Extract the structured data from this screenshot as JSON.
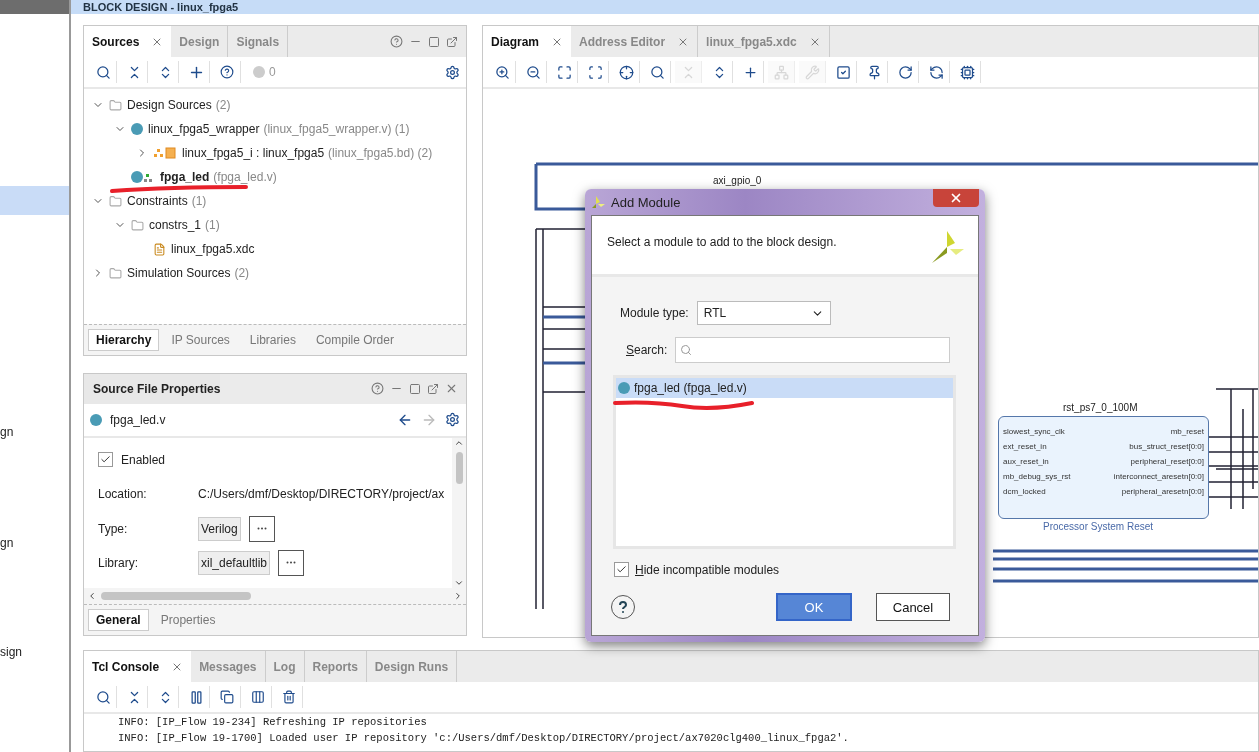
{
  "header": {
    "title": "BLOCK DESIGN - linux_fpga5"
  },
  "left_strip": {
    "items": [
      {
        "label": "gn"
      },
      {
        "label": "gn"
      },
      {
        "label": "sign"
      }
    ]
  },
  "sources_panel": {
    "tabs": [
      {
        "label": "Sources",
        "selected": true,
        "closable": true
      },
      {
        "label": "Design",
        "selected": false,
        "closable": false
      },
      {
        "label": "Signals",
        "selected": false,
        "closable": false
      }
    ],
    "warning_count": "0",
    "tree": [
      {
        "label": "Design Sources",
        "note": "(2)",
        "kind": "folder",
        "expanded": true,
        "bold": false,
        "children": [
          {
            "label": "linux_fpga5_wrapper",
            "note": "(linux_fpga5_wrapper.v) (1)",
            "kind": "module",
            "expanded": true,
            "bold": false,
            "children": [
              {
                "label": "linux_fpga5_i : linux_fpga5",
                "note": "(linux_fpga5.bd) (2)",
                "kind": "block-design",
                "expanded": false,
                "bold": false
              }
            ]
          },
          {
            "label": "fpga_led",
            "note": "(fpga_led.v)",
            "kind": "top-module",
            "bold": true
          }
        ]
      },
      {
        "label": "Constraints",
        "note": "(1)",
        "kind": "folder",
        "expanded": true,
        "bold": false,
        "children": [
          {
            "label": "constrs_1",
            "note": "(1)",
            "kind": "folder",
            "expanded": true,
            "bold": false,
            "children": [
              {
                "label": "linux_fpga5.xdc",
                "kind": "file",
                "bold": false
              }
            ]
          }
        ]
      },
      {
        "label": "Simulation Sources",
        "note": "(2)",
        "kind": "folder",
        "expanded": false,
        "bold": false
      }
    ],
    "bottom_tabs": [
      {
        "label": "Hierarchy",
        "selected": true
      },
      {
        "label": "IP Sources",
        "selected": false
      },
      {
        "label": "Libraries",
        "selected": false
      },
      {
        "label": "Compile Order",
        "selected": false
      }
    ]
  },
  "properties_panel": {
    "title": "Source File Properties",
    "file": "fpga_led.v",
    "enabled": {
      "label": "Enabled",
      "checked": true
    },
    "fields": [
      {
        "label": "Location:",
        "value": "C:/Users/dmf/Desktop/DIRECTORY/project/ax",
        "kind": "text"
      },
      {
        "label": "Type:",
        "value": "Verilog",
        "kind": "box"
      },
      {
        "label": "Library:",
        "value": "xil_defaultlib",
        "kind": "box"
      }
    ],
    "tabs": [
      {
        "label": "General",
        "selected": true
      },
      {
        "label": "Properties",
        "selected": false
      }
    ]
  },
  "diagram_panel": {
    "tabs": [
      {
        "label": "Diagram",
        "selected": true,
        "closable": true
      },
      {
        "label": "Address Editor",
        "selected": false,
        "closable": true
      },
      {
        "label": "linux_fpga5.xdc",
        "selected": false,
        "closable": true
      }
    ],
    "toolbar": [
      {
        "disabled": false
      },
      {
        "disabled": false
      },
      {
        "disabled": false
      },
      {
        "disabled": false
      },
      {
        "disabled": false
      },
      {
        "disabled": false
      },
      {
        "disabled": true
      },
      {
        "disabled": false
      },
      {
        "disabled": false
      },
      {
        "disabled": true
      },
      {
        "disabled": true
      },
      {
        "disabled": false
      },
      {
        "disabled": false
      },
      {
        "disabled": false
      },
      {
        "disabled": false
      },
      {
        "disabled": false
      }
    ],
    "canvas": {
      "gpio_label": "axi_gpio_0",
      "block": {
        "name": "rst_ps7_0_100M",
        "subtitle": "Processor System Reset",
        "left_ports": [
          "slowest_sync_clk",
          "ext_reset_in",
          "aux_reset_in",
          "mb_debug_sys_rst",
          "dcm_locked"
        ],
        "right_ports": [
          "mb_reset",
          "bus_struct_reset[0:0]",
          "peripheral_reset[0:0]",
          "interconnect_aresetn[0:0]",
          "peripheral_aresetn[0:0]"
        ]
      }
    }
  },
  "dialog": {
    "title": "Add Module",
    "description": "Select a module to add to the block design.",
    "module_type": {
      "label": "Module type:",
      "value": "RTL"
    },
    "search": {
      "label": "Search:"
    },
    "modules": [
      {
        "label": "fpga_led (fpga_led.v)",
        "selected": true
      }
    ],
    "hide_incompatible": {
      "label": "Hide incompatible modules",
      "checked": true
    },
    "buttons": [
      {
        "label": "OK",
        "kind": "primary"
      },
      {
        "label": "Cancel",
        "kind": "secondary"
      }
    ]
  },
  "console": {
    "tabs": [
      {
        "label": "Tcl Console",
        "selected": true,
        "closable": true
      },
      {
        "label": "Messages",
        "selected": false,
        "closable": false
      },
      {
        "label": "Log",
        "selected": false,
        "closable": false
      },
      {
        "label": "Reports",
        "selected": false,
        "closable": false
      },
      {
        "label": "Design Runs",
        "selected": false,
        "closable": false
      }
    ],
    "lines": [
      "INFO: [IP_Flow 19-234] Refreshing IP repositories",
      "INFO: [IP_Flow 19-1700] Loaded user IP repository 'c:/Users/dmf/Desktop/DIRECTORY/project/ax7020clg400_linux_fpga2'."
    ]
  }
}
